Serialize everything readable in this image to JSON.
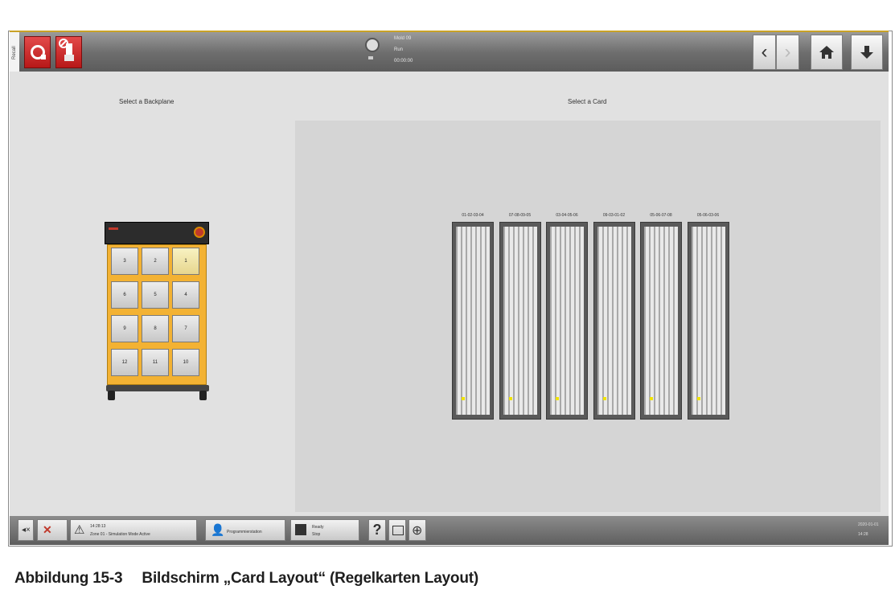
{
  "window": {
    "side_tab": "Recall",
    "status_lines": [
      "Mold 09",
      "Run",
      "00:00:00"
    ]
  },
  "left_panel": {
    "title": "Select a Backplane",
    "cells": [
      "3",
      "2",
      "1",
      "6",
      "5",
      "4",
      "9",
      "8",
      "7",
      "12",
      "11",
      "10"
    ],
    "selected": "1"
  },
  "right_panel": {
    "title": "Select a Card",
    "slots": [
      "01-02-03-04",
      "07-08-09-05",
      "03-04-05-06",
      "09-03-01-02",
      "05-06-07-08",
      "05-06-03-06"
    ]
  },
  "bottombar": {
    "alarm_time": "14:28:13",
    "alarm_text": "Zone 01 - Simulation Mode Active",
    "user_label": "Programmierstation",
    "process_label": "Ready",
    "process_sub": "Stop",
    "clock_date": "2020-01-01",
    "clock_time": "14:28"
  },
  "caption": {
    "number": "Abbildung 15-3",
    "text": "Bildschirm „Card Layout“ (Regelkarten Layout)"
  },
  "colors": {
    "accent": "#c9a227",
    "cabinet": "#f3b233",
    "alarm_red": "#c0392b"
  }
}
